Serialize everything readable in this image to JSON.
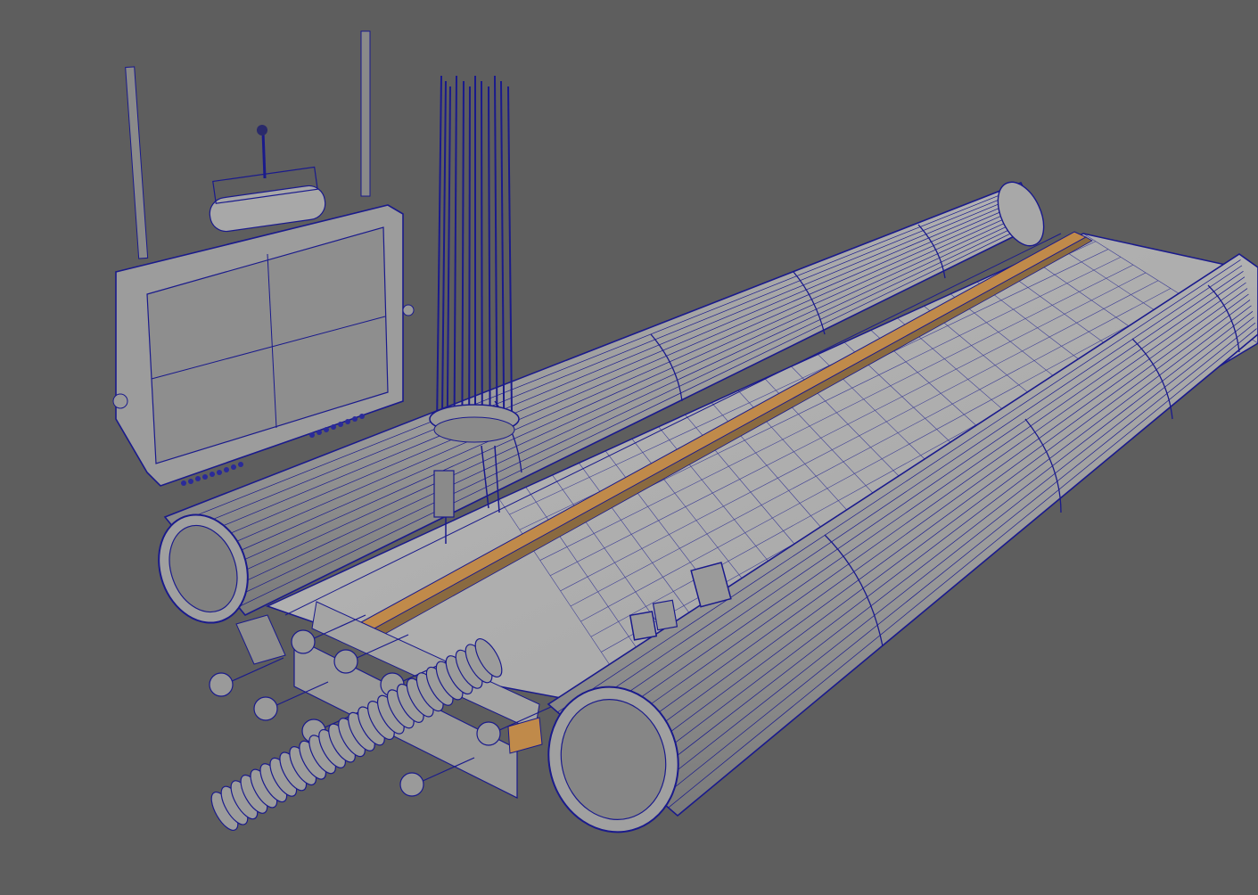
{
  "viewport": {
    "background_color": "#5e5e5e",
    "shading_mode": "wireframe-on-shaded",
    "wire_color": "#1a1a8c",
    "surface_color": "#9a9a9a",
    "accent_strip_color": "#c08a4a"
  },
  "scene": {
    "objects": [
      "back-tube",
      "front-tube",
      "grid-bed",
      "rail",
      "monitor-panel",
      "probe-bundle",
      "coil-spring",
      "knob-bracket-assembly",
      "small-brackets"
    ]
  }
}
